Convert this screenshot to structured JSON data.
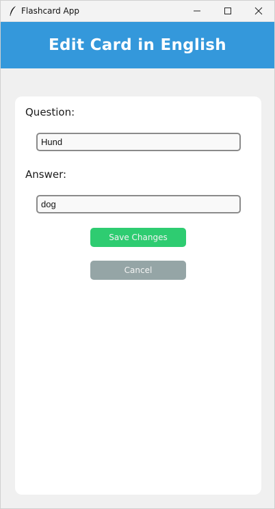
{
  "window": {
    "title": "Flashcard App",
    "minimize_icon": "minimize-icon",
    "maximize_icon": "maximize-icon",
    "close_icon": "close-icon",
    "app_icon": "feather-icon"
  },
  "header": {
    "title": "Edit Card in English",
    "background": "#3498db"
  },
  "form": {
    "question_label": "Question:",
    "question_value": "Hund",
    "answer_label": "Answer:",
    "answer_value": "dog",
    "save_label": "Save Changes",
    "cancel_label": "Cancel",
    "save_color": "#2ecc71",
    "cancel_color": "#95a5a6"
  }
}
